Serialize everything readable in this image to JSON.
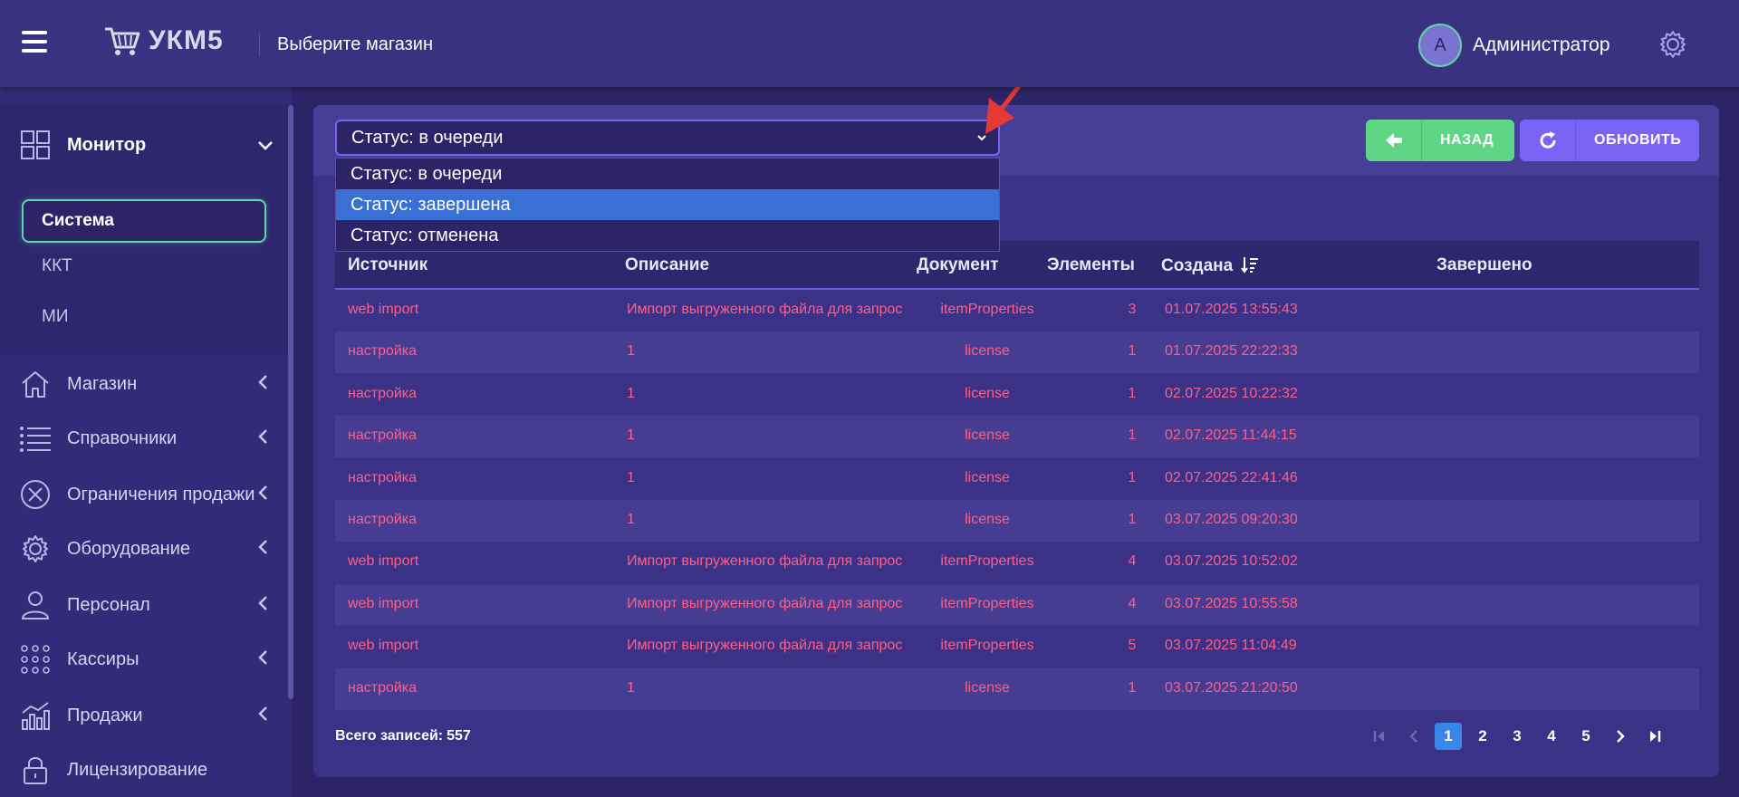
{
  "header": {
    "logo": "УКМ5",
    "shop_select": "Выберите магазин",
    "user_initial": "A",
    "user_name": "Администратор"
  },
  "sidebar": {
    "monitor": {
      "label": "Монитор",
      "sub_items": [
        "Система",
        "ККТ",
        "МИ"
      ],
      "active": "Система"
    },
    "items": [
      {
        "label": "Магазин",
        "icon": "home-icon"
      },
      {
        "label": "Справочники",
        "icon": "list-icon"
      },
      {
        "label": "Ограничения продажи",
        "icon": "restriction-icon"
      },
      {
        "label": "Оборудование",
        "icon": "gear-icon"
      },
      {
        "label": "Персонал",
        "icon": "person-icon"
      },
      {
        "label": "Кассиры",
        "icon": "grid-dots-icon"
      },
      {
        "label": "Продажи",
        "icon": "chart-icon"
      },
      {
        "label": "Лицензирование",
        "icon": "lock-icon"
      }
    ]
  },
  "filter": {
    "selected": "Статус: в очереди",
    "options": [
      "Статус: в очереди",
      "Статус: завершена",
      "Статус: отменена"
    ],
    "highlighted_index": 1
  },
  "buttons": {
    "back": "НАЗАД",
    "refresh": "ОБНОВИТЬ"
  },
  "table": {
    "columns": [
      "Источник",
      "Описание",
      "Документ",
      "Элементы",
      "Создана",
      "Завершено"
    ],
    "rows": [
      [
        "web import",
        "Импорт выгруженного файла для запроса",
        "itemProperties",
        "3",
        "01.07.2025 13:55:43",
        ""
      ],
      [
        "настройка",
        "1",
        "license",
        "1",
        "01.07.2025 22:22:33",
        ""
      ],
      [
        "настройка",
        "1",
        "license",
        "1",
        "02.07.2025 10:22:32",
        ""
      ],
      [
        "настройка",
        "1",
        "license",
        "1",
        "02.07.2025 11:44:15",
        ""
      ],
      [
        "настройка",
        "1",
        "license",
        "1",
        "02.07.2025 22:41:46",
        ""
      ],
      [
        "настройка",
        "1",
        "license",
        "1",
        "03.07.2025 09:20:30",
        ""
      ],
      [
        "web import",
        "Импорт выгруженного файла для запроса",
        "itemProperties",
        "4",
        "03.07.2025 10:52:02",
        ""
      ],
      [
        "web import",
        "Импорт выгруженного файла для запроса",
        "itemProperties",
        "4",
        "03.07.2025 10:55:58",
        ""
      ],
      [
        "web import",
        "Импорт выгруженного файла для запроса",
        "itemProperties",
        "5",
        "03.07.2025 11:04:49",
        ""
      ],
      [
        "настройка",
        "1",
        "license",
        "1",
        "03.07.2025 21:20:50",
        ""
      ]
    ]
  },
  "footer": {
    "total_label": "Всего записей:",
    "total_value": "557",
    "pages": [
      "1",
      "2",
      "3",
      "4",
      "5"
    ],
    "current_page": "1"
  },
  "colors": {
    "background": "#2c2466",
    "header": "#3a3180",
    "accent_green": "#5ed686",
    "accent_purple": "#7a64f5",
    "row_text": "#ff5f86",
    "active_page": "#3a86e8"
  }
}
